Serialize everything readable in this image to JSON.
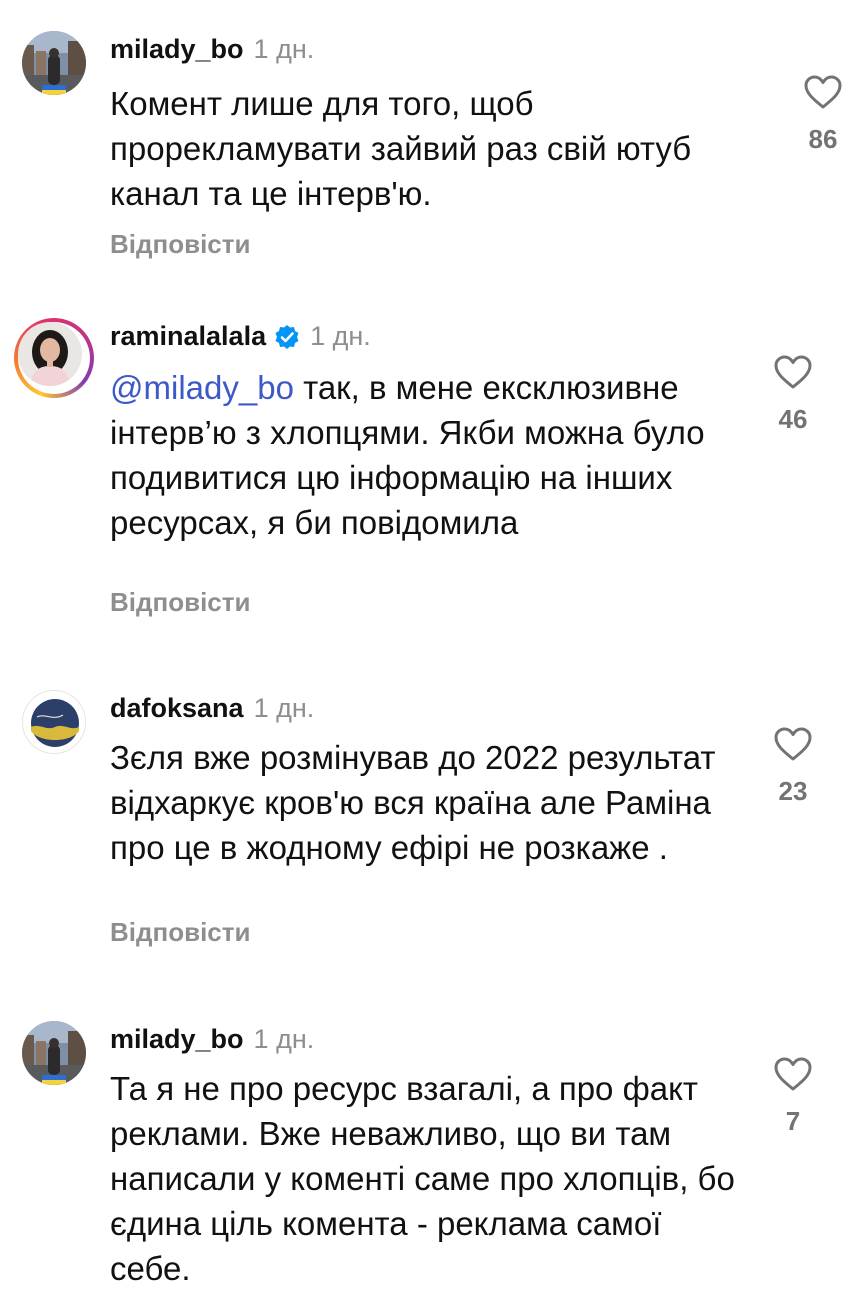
{
  "comments": [
    {
      "username": "milady_bo",
      "verified": false,
      "time": "1 дн.",
      "text": "Комент лише для того, щоб прорекламувати зайвий раз свій ютуб канал та це інтерв'ю.",
      "reply_label": "Відповісти",
      "likes": "86",
      "avatar": "city-street-photo-avatar"
    },
    {
      "username": "raminalalala",
      "verified": true,
      "time": "1 дн.",
      "mention": "@milady_bo",
      "text": " так, в мене ексклюзивне інтерв’ю з хлопцями. Якби можна було подивитися цю інформацію на інших ресурсах, я би повідомила",
      "reply_label": "Відповісти",
      "likes": "46",
      "avatar": "portrait-photo-avatar"
    },
    {
      "username": "dafoksana",
      "verified": false,
      "time": "1 дн.",
      "text": "Зєля вже розмінував до 2022 результат відхаркує кров'ю вся країна але Раміна про це в жодному ефірі не розкаже .",
      "reply_label": "Відповісти",
      "likes": "23",
      "avatar": "ukraine-flag-art-avatar"
    },
    {
      "username": "milady_bo",
      "verified": false,
      "time": "1 дн.",
      "text": "Та я не про ресурс взагалі, а про факт реклами. Вже неважливо, що ви там написали у коменті саме про хлопців, бо єдина ціль комента - реклама самої себе.",
      "reply_label": "",
      "likes": "7",
      "avatar": "city-street-photo-avatar"
    }
  ],
  "icons": {
    "like": "heart-outline-icon",
    "verified": "verified-badge-icon"
  },
  "colors": {
    "mention": "#3d59c7",
    "muted": "#8e8e8e",
    "verified": "#0095f6"
  }
}
